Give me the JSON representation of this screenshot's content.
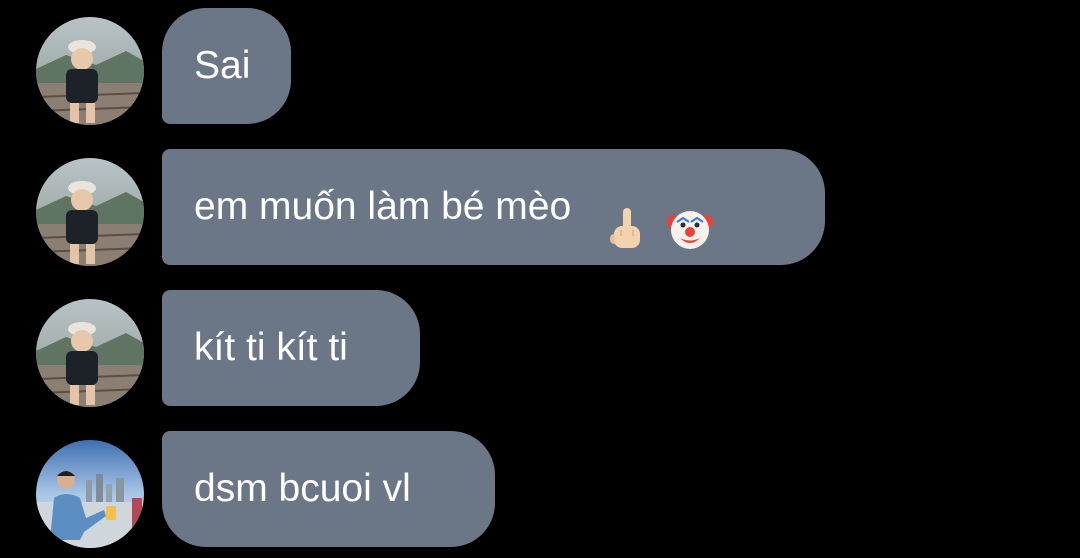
{
  "messages": [
    {
      "text": "Sai",
      "sender": "boy-avatar",
      "emojis": []
    },
    {
      "text": "em muốn làm bé mèo",
      "sender": "boy-avatar",
      "emojis": [
        "middle-finger-emoji",
        "clown-face-emoji"
      ]
    },
    {
      "text": "kít ti kít ti",
      "sender": "boy-avatar",
      "emojis": []
    },
    {
      "text": "dsm bcuoi vl",
      "sender": "man-avatar",
      "emojis": []
    }
  ],
  "colors": {
    "background": "#000000",
    "bubble": "#6b7786",
    "text": "#ffffff"
  }
}
